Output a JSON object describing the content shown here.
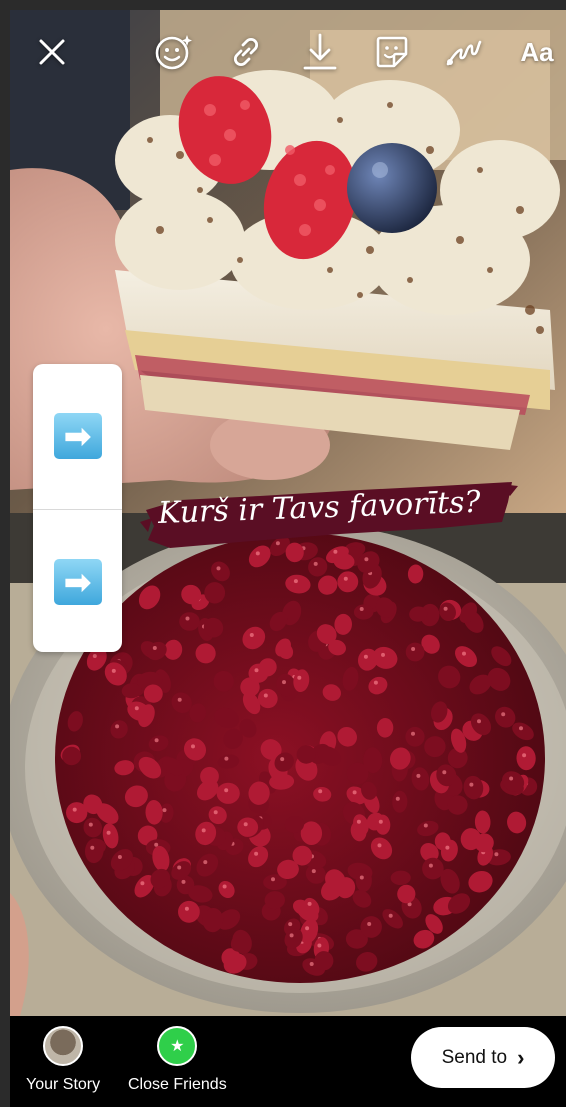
{
  "toolbar": {
    "close_icon": "close-icon",
    "effects_icon": "sparkle-face-icon",
    "link_icon": "link-icon",
    "download_icon": "download-icon",
    "sticker_icon": "sticker-icon",
    "draw_icon": "scribble-icon",
    "text_label": "Aa"
  },
  "story": {
    "top_photo": "cake-with-raspberries-and-blueberry",
    "bottom_photo": "bowl-of-pomegranate-seeds"
  },
  "poll": {
    "options": [
      {
        "emoji": "right-arrow-emoji"
      },
      {
        "emoji": "right-arrow-emoji"
      }
    ],
    "arrow_glyph": "➡"
  },
  "question": {
    "text": "Kurš ir Tavs favorīts?",
    "color": "#5a0e24"
  },
  "bottom": {
    "your_story_label": "Your Story",
    "close_friends_label": "Close Friends",
    "send_label": "Send to",
    "send_chevron": "›",
    "close_friends_color": "#2fcf4a"
  }
}
